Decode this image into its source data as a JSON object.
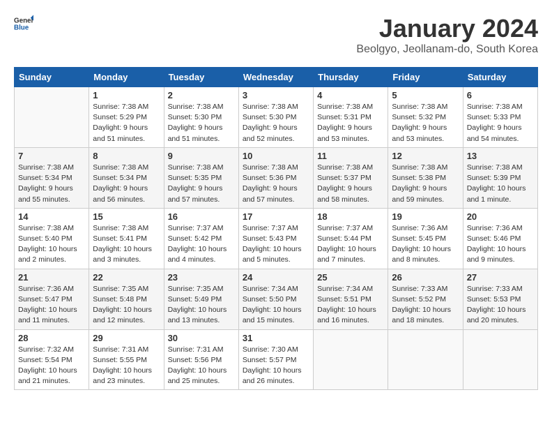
{
  "header": {
    "logo_general": "General",
    "logo_blue": "Blue",
    "title": "January 2024",
    "subtitle": "Beolgyo, Jeollanam-do, South Korea"
  },
  "calendar": {
    "weekdays": [
      "Sunday",
      "Monday",
      "Tuesday",
      "Wednesday",
      "Thursday",
      "Friday",
      "Saturday"
    ],
    "weeks": [
      [
        {
          "day": "",
          "detail": ""
        },
        {
          "day": "1",
          "detail": "Sunrise: 7:38 AM\nSunset: 5:29 PM\nDaylight: 9 hours\nand 51 minutes."
        },
        {
          "day": "2",
          "detail": "Sunrise: 7:38 AM\nSunset: 5:30 PM\nDaylight: 9 hours\nand 51 minutes."
        },
        {
          "day": "3",
          "detail": "Sunrise: 7:38 AM\nSunset: 5:30 PM\nDaylight: 9 hours\nand 52 minutes."
        },
        {
          "day": "4",
          "detail": "Sunrise: 7:38 AM\nSunset: 5:31 PM\nDaylight: 9 hours\nand 53 minutes."
        },
        {
          "day": "5",
          "detail": "Sunrise: 7:38 AM\nSunset: 5:32 PM\nDaylight: 9 hours\nand 53 minutes."
        },
        {
          "day": "6",
          "detail": "Sunrise: 7:38 AM\nSunset: 5:33 PM\nDaylight: 9 hours\nand 54 minutes."
        }
      ],
      [
        {
          "day": "7",
          "detail": "Sunrise: 7:38 AM\nSunset: 5:34 PM\nDaylight: 9 hours\nand 55 minutes."
        },
        {
          "day": "8",
          "detail": "Sunrise: 7:38 AM\nSunset: 5:34 PM\nDaylight: 9 hours\nand 56 minutes."
        },
        {
          "day": "9",
          "detail": "Sunrise: 7:38 AM\nSunset: 5:35 PM\nDaylight: 9 hours\nand 57 minutes."
        },
        {
          "day": "10",
          "detail": "Sunrise: 7:38 AM\nSunset: 5:36 PM\nDaylight: 9 hours\nand 57 minutes."
        },
        {
          "day": "11",
          "detail": "Sunrise: 7:38 AM\nSunset: 5:37 PM\nDaylight: 9 hours\nand 58 minutes."
        },
        {
          "day": "12",
          "detail": "Sunrise: 7:38 AM\nSunset: 5:38 PM\nDaylight: 9 hours\nand 59 minutes."
        },
        {
          "day": "13",
          "detail": "Sunrise: 7:38 AM\nSunset: 5:39 PM\nDaylight: 10 hours\nand 1 minute."
        }
      ],
      [
        {
          "day": "14",
          "detail": "Sunrise: 7:38 AM\nSunset: 5:40 PM\nDaylight: 10 hours\nand 2 minutes."
        },
        {
          "day": "15",
          "detail": "Sunrise: 7:38 AM\nSunset: 5:41 PM\nDaylight: 10 hours\nand 3 minutes."
        },
        {
          "day": "16",
          "detail": "Sunrise: 7:37 AM\nSunset: 5:42 PM\nDaylight: 10 hours\nand 4 minutes."
        },
        {
          "day": "17",
          "detail": "Sunrise: 7:37 AM\nSunset: 5:43 PM\nDaylight: 10 hours\nand 5 minutes."
        },
        {
          "day": "18",
          "detail": "Sunrise: 7:37 AM\nSunset: 5:44 PM\nDaylight: 10 hours\nand 7 minutes."
        },
        {
          "day": "19",
          "detail": "Sunrise: 7:36 AM\nSunset: 5:45 PM\nDaylight: 10 hours\nand 8 minutes."
        },
        {
          "day": "20",
          "detail": "Sunrise: 7:36 AM\nSunset: 5:46 PM\nDaylight: 10 hours\nand 9 minutes."
        }
      ],
      [
        {
          "day": "21",
          "detail": "Sunrise: 7:36 AM\nSunset: 5:47 PM\nDaylight: 10 hours\nand 11 minutes."
        },
        {
          "day": "22",
          "detail": "Sunrise: 7:35 AM\nSunset: 5:48 PM\nDaylight: 10 hours\nand 12 minutes."
        },
        {
          "day": "23",
          "detail": "Sunrise: 7:35 AM\nSunset: 5:49 PM\nDaylight: 10 hours\nand 13 minutes."
        },
        {
          "day": "24",
          "detail": "Sunrise: 7:34 AM\nSunset: 5:50 PM\nDaylight: 10 hours\nand 15 minutes."
        },
        {
          "day": "25",
          "detail": "Sunrise: 7:34 AM\nSunset: 5:51 PM\nDaylight: 10 hours\nand 16 minutes."
        },
        {
          "day": "26",
          "detail": "Sunrise: 7:33 AM\nSunset: 5:52 PM\nDaylight: 10 hours\nand 18 minutes."
        },
        {
          "day": "27",
          "detail": "Sunrise: 7:33 AM\nSunset: 5:53 PM\nDaylight: 10 hours\nand 20 minutes."
        }
      ],
      [
        {
          "day": "28",
          "detail": "Sunrise: 7:32 AM\nSunset: 5:54 PM\nDaylight: 10 hours\nand 21 minutes."
        },
        {
          "day": "29",
          "detail": "Sunrise: 7:31 AM\nSunset: 5:55 PM\nDaylight: 10 hours\nand 23 minutes."
        },
        {
          "day": "30",
          "detail": "Sunrise: 7:31 AM\nSunset: 5:56 PM\nDaylight: 10 hours\nand 25 minutes."
        },
        {
          "day": "31",
          "detail": "Sunrise: 7:30 AM\nSunset: 5:57 PM\nDaylight: 10 hours\nand 26 minutes."
        },
        {
          "day": "",
          "detail": ""
        },
        {
          "day": "",
          "detail": ""
        },
        {
          "day": "",
          "detail": ""
        }
      ]
    ]
  }
}
